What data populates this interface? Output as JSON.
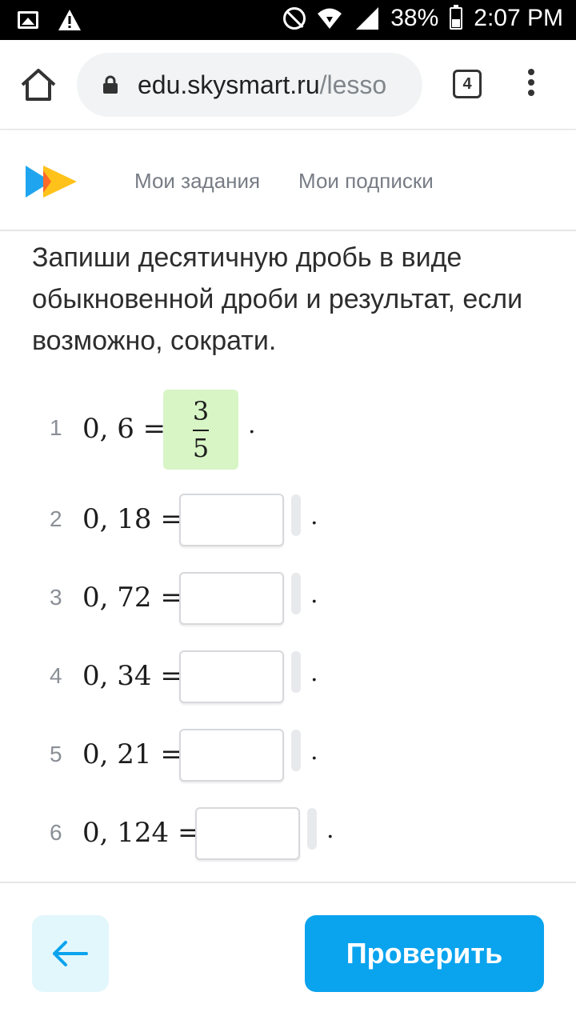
{
  "status_bar": {
    "battery": "38%",
    "time": "2:07 PM",
    "icons": [
      "image-icon",
      "warning-icon",
      "do-not-disturb-icon",
      "wifi-icon",
      "signal-icon",
      "battery-icon"
    ]
  },
  "browser": {
    "url_main": "edu.skysmart.ru",
    "url_rest": "/lesso",
    "tab_count": "4"
  },
  "site_header": {
    "nav": [
      "Мои задания",
      "Мои подписки"
    ]
  },
  "task": {
    "instruction": "Запиши десятичную дробь в виде обыкновенной дроби и результат, если возможно, сократи.",
    "rows": [
      {
        "num": "1",
        "expr": "0, 6 =",
        "answer_numerator": "3",
        "answer_denominator": "5",
        "tail": "."
      },
      {
        "num": "2",
        "expr": "0, 18 =",
        "tail": "."
      },
      {
        "num": "3",
        "expr": "0, 72 =",
        "tail": "."
      },
      {
        "num": "4",
        "expr": "0, 34 =",
        "tail": "."
      },
      {
        "num": "5",
        "expr": "0, 21 =",
        "tail": "."
      },
      {
        "num": "6",
        "expr": "0, 124 =",
        "tail": "."
      }
    ]
  },
  "footer": {
    "back_icon": "arrow-left-icon",
    "check_label": "Проверить"
  },
  "colors": {
    "accent": "#0aa3ee",
    "answered_bg": "#d8f5c5",
    "back_bg": "#e2f7fc"
  }
}
